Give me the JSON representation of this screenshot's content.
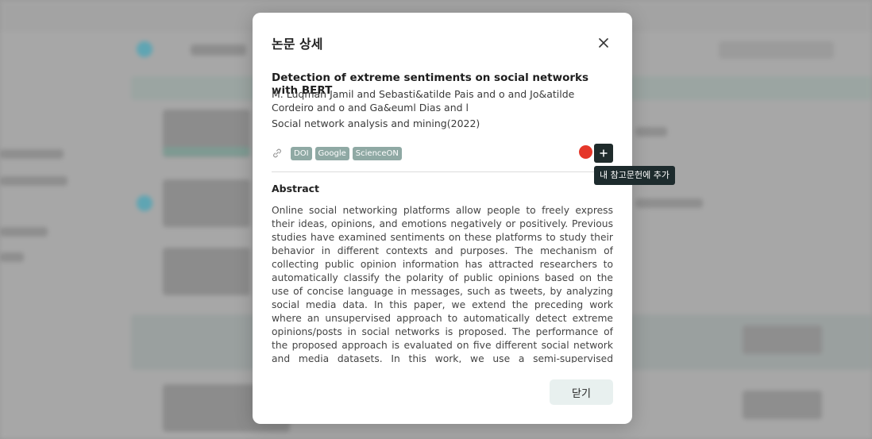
{
  "modal": {
    "title": "논문 상세",
    "paper_title": "Detection of extreme sentiments on social networks with BERT",
    "authors": "M. Luqman Jamil and Sebasti&atilde Pais and o and Jo&atilde Cordeiro and o and Ga&euml Dias and l",
    "journal": "Social network analysis and mining(2022)",
    "link_tags": [
      "DOI",
      "Google",
      "ScienceON"
    ],
    "add_tooltip": "내 참고문헌에 추가",
    "abstract_heading": "Abstract",
    "abstract": "Online social networking platforms allow people to freely express their ideas, opinions, and emotions negatively or positively. Previous studies have examined sentiments on these platforms to study their behavior in different contexts and purposes. The mechanism of collecting public opinion information has attracted researchers to automatically classify the polarity of public opinions based on the use of concise language in messages, such as tweets, by analyzing social media data. In this paper, we extend the preceding work where an unsupervised approach to automatically detect extreme opinions/posts in social networks is proposed. The performance of the proposed approach is evaluated on five different social network and media datasets. In this work, we use a semi-supervised approach known as BERT to reevaluate the accuracy of our prior approach and the obtained",
    "close_button": "닫기"
  },
  "icons": {
    "close": "close-icon",
    "link": "link-icon",
    "add": "plus-icon"
  },
  "colors": {
    "tag": "#8fa9a4",
    "add_button": "#1f2b2b",
    "red_dot": "#e5372a",
    "footer_button": "#e8f0ef"
  }
}
